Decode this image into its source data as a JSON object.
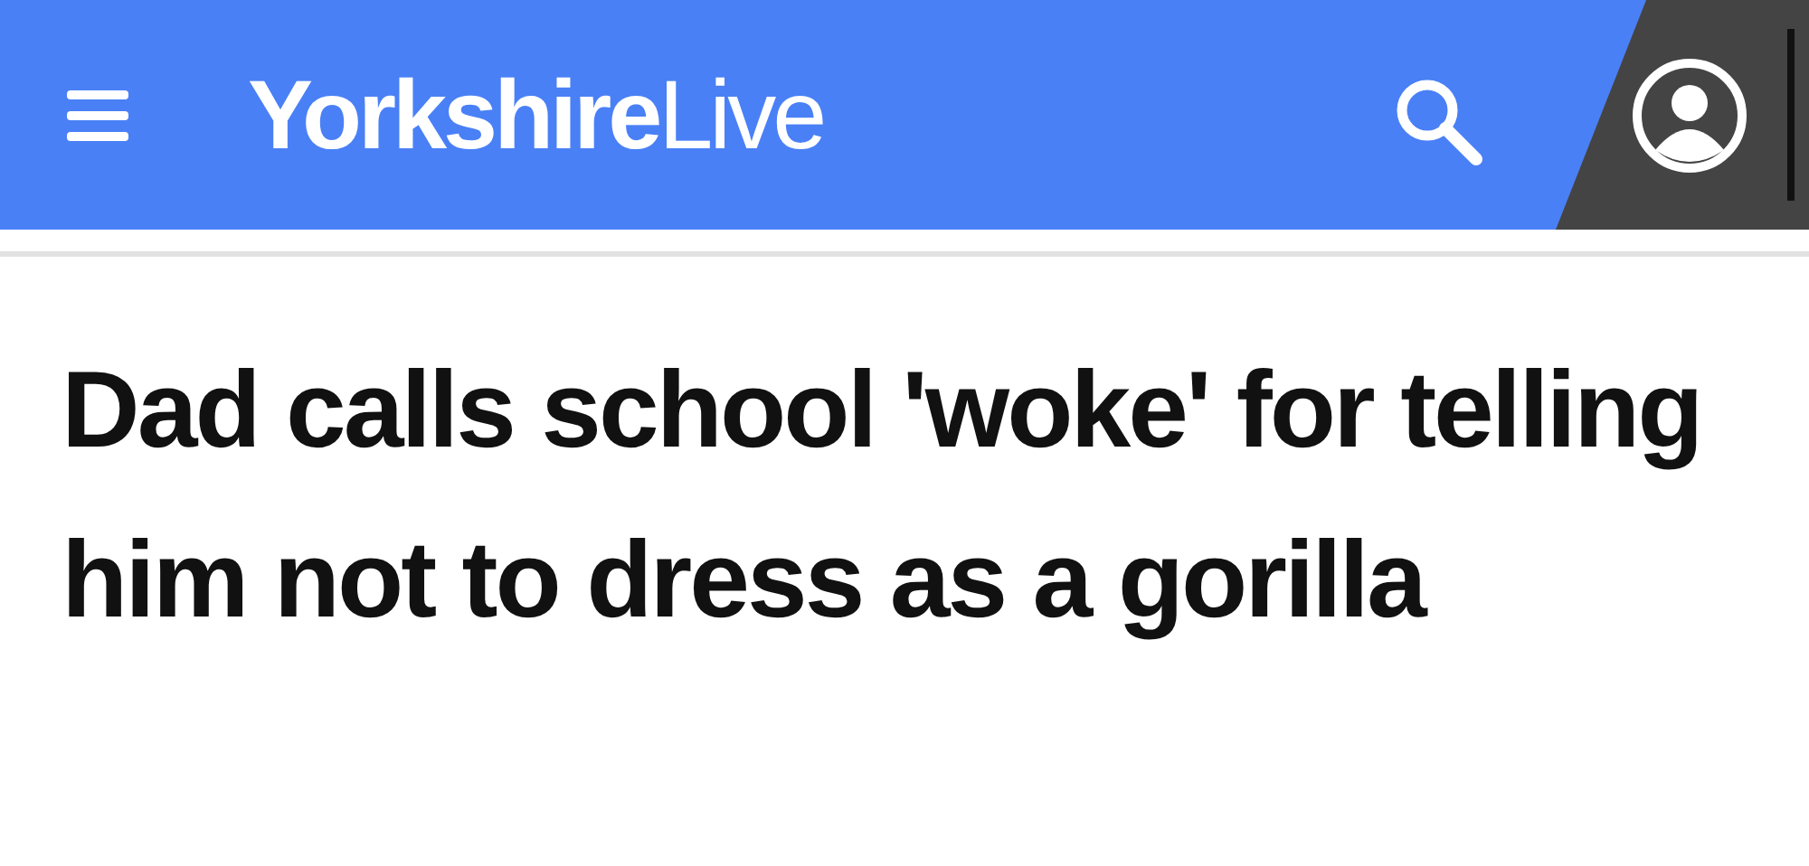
{
  "header": {
    "logo": "**Yorkshire**Live"
  },
  "article": {
    "headline": "Dad calls school 'woke' for telling him not to dress as a gorilla"
  }
}
